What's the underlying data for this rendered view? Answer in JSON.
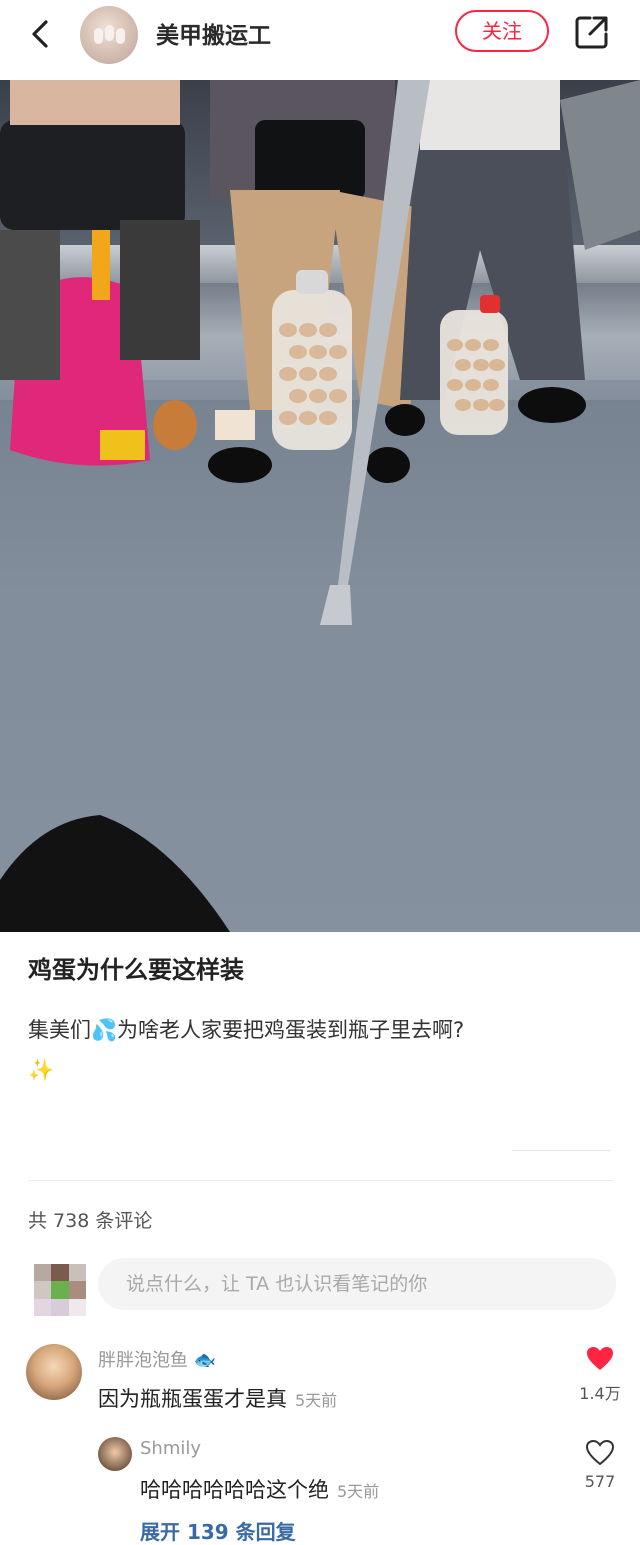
{
  "header": {
    "author_name": "美甲搬运工",
    "follow_label": "关注"
  },
  "post": {
    "title": "鸡蛋为什么要这样装",
    "body_prefix": "集美们",
    "body_main": "为啥老人家要把鸡蛋装到瓶子里去啊?",
    "emoji_sweat": "💦",
    "emoji_sparkle": "✨"
  },
  "comments_section": {
    "count_text": "共 738 条评论",
    "input_placeholder": "说点什么，让 TA 也认识看笔记的你"
  },
  "comments": [
    {
      "user": "胖胖泡泡鱼",
      "user_emoji": "🐟",
      "text": "因为瓶瓶蛋蛋才是真",
      "time": "5天前",
      "likes": "1.4万",
      "liked": true
    },
    {
      "user": "Shmily",
      "text": "哈哈哈哈哈哈这个绝",
      "time": "5天前",
      "likes": "577",
      "liked": false
    }
  ],
  "replies": {
    "expand_label": "展开 139 条回复"
  },
  "colors": {
    "accent": "#ff2442",
    "link": "#3a6aa5"
  }
}
